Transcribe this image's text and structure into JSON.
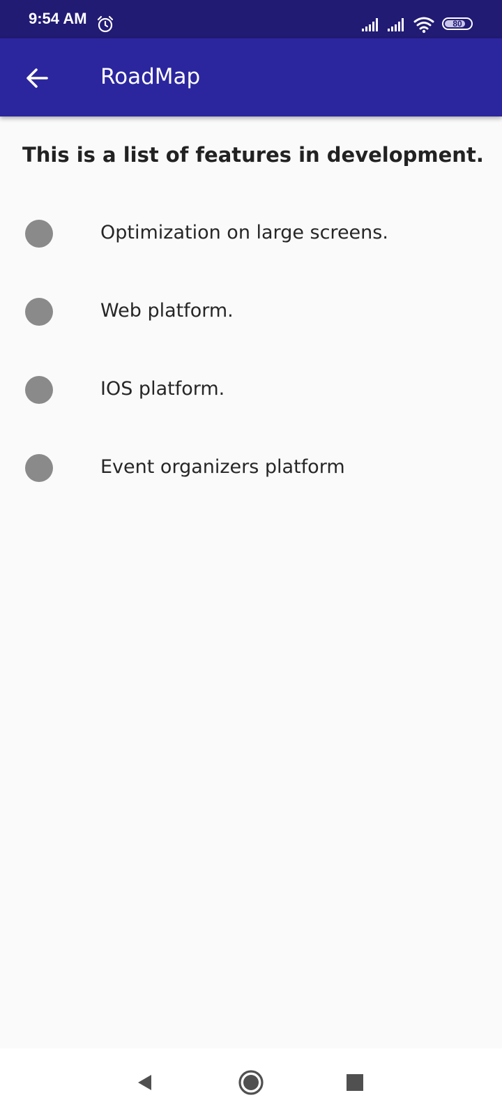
{
  "status_bar": {
    "time": "9:54 AM",
    "battery_level": "80",
    "battery_fraction": 0.8,
    "icons": [
      "alarm-icon",
      "signal-icon",
      "signal-icon",
      "wifi-icon",
      "battery-icon"
    ]
  },
  "app_bar": {
    "title": "RoadMap",
    "back_icon": "arrow-left-icon"
  },
  "content": {
    "intro": "This is a list of features in development.",
    "features": [
      {
        "label": "Optimization on large screens."
      },
      {
        "label": "Web platform."
      },
      {
        "label": "IOS platform."
      },
      {
        "label": "Event organizers platform"
      }
    ]
  },
  "nav_bar": {
    "buttons": [
      "back-triangle-icon",
      "home-circle-icon",
      "recents-square-icon"
    ]
  },
  "colors": {
    "status_bar": "#211b74",
    "app_bar": "#2b269e",
    "background": "#fafafa",
    "dot": "#8a8a8a"
  }
}
